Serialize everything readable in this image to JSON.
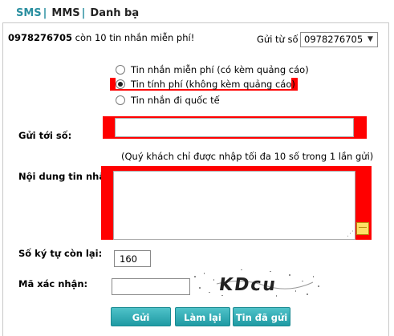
{
  "tabs": {
    "sms": "SMS",
    "sep1": "|",
    "mms": "MMS",
    "sep2": "|",
    "contacts": "Danh bạ"
  },
  "quota": {
    "number": "0978276705",
    "text": " còn 10 tin nhắn miễn phí!"
  },
  "from": {
    "label": "Gửi từ số",
    "selected": "0978276705"
  },
  "message_types": [
    {
      "label": "Tin nhắn miễn phí (có kèm quảng cáo)",
      "checked": false
    },
    {
      "label": "Tin tính phí (không kèm quảng cáo)",
      "checked": true
    },
    {
      "label": "Tin nhắn đi quốc tế",
      "checked": false
    }
  ],
  "to": {
    "label": "Gửi tới số:",
    "value": "",
    "note": "(Quý khách chỉ được nhập tối đa 10 số trong 1 lần gửi)"
  },
  "content": {
    "label": "Nội dung tin nhắn:",
    "value": ""
  },
  "remaining": {
    "label": "Số ký tự còn lại:",
    "value": "160"
  },
  "captcha": {
    "label": "Mã xác nhận:",
    "value": "",
    "image_text": "KDcu"
  },
  "buttons": {
    "send": "Gửi",
    "reset": "Làm lại",
    "sent": "Tin đã gửi"
  },
  "colors": {
    "accent": "#2a8fa0",
    "highlight": "#ff0000",
    "button": "#1f9aa3"
  }
}
